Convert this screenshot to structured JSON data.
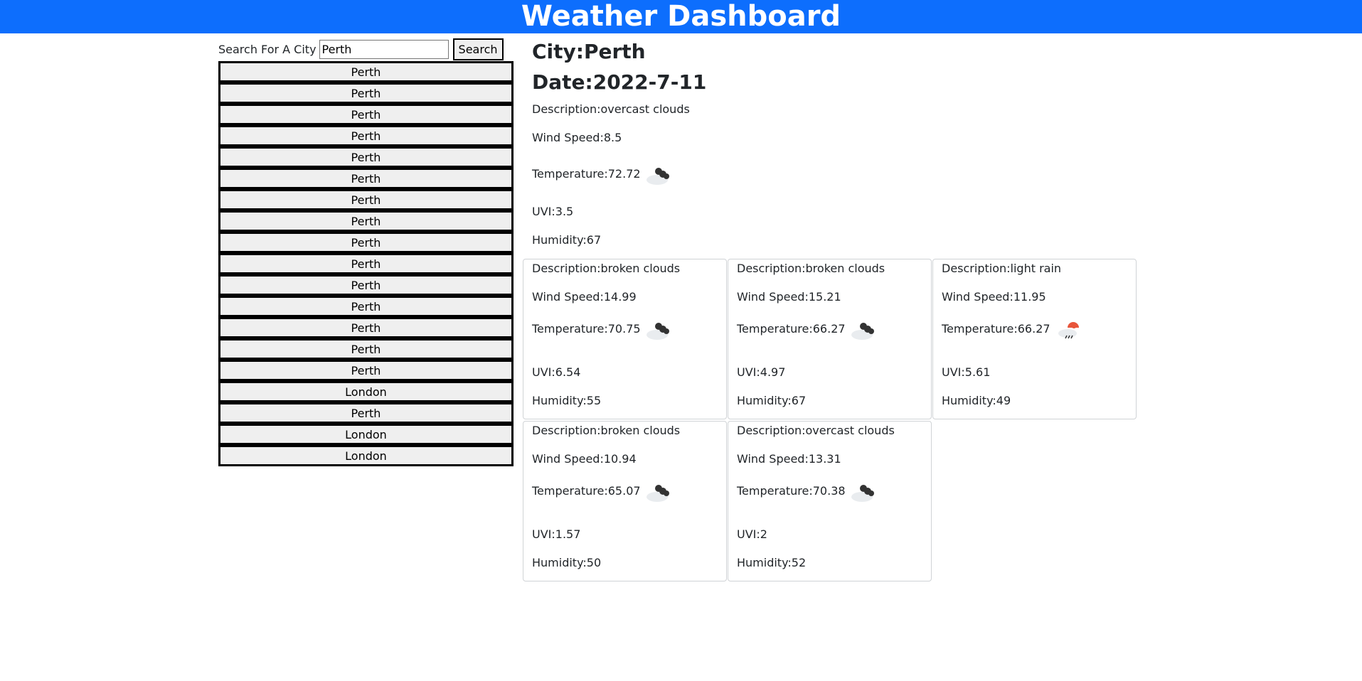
{
  "header": {
    "title": "Weather Dashboard"
  },
  "search": {
    "label": "Search For A City",
    "value": "Perth",
    "button_label": "Search"
  },
  "history": [
    "Perth",
    "Perth",
    "Perth",
    "Perth",
    "Perth",
    "Perth",
    "Perth",
    "Perth",
    "Perth",
    "Perth",
    "Perth",
    "Perth",
    "Perth",
    "Perth",
    "Perth",
    "London",
    "Perth",
    "London",
    "London"
  ],
  "current": {
    "city": "City:Perth",
    "date": "Date:2022-7-11",
    "description": "Description:overcast clouds",
    "wind": "Wind Speed:8.5",
    "temperature": "Temperature:72.72",
    "icon": "overcast-clouds-icon",
    "uvi": "UVI:3.5",
    "humidity": "Humidity:67"
  },
  "forecast": [
    {
      "description": "Description:broken clouds",
      "wind": "Wind Speed:14.99",
      "temperature": "Temperature:70.75",
      "icon": "broken-clouds-icon",
      "uvi": "UVI:6.54",
      "humidity": "Humidity:55"
    },
    {
      "description": "Description:broken clouds",
      "wind": "Wind Speed:15.21",
      "temperature": "Temperature:66.27",
      "icon": "broken-clouds-icon",
      "uvi": "UVI:4.97",
      "humidity": "Humidity:67"
    },
    {
      "description": "Description:light rain",
      "wind": "Wind Speed:11.95",
      "temperature": "Temperature:66.27",
      "icon": "light-rain-icon",
      "uvi": "UVI:5.61",
      "humidity": "Humidity:49"
    },
    {
      "description": "Description:broken clouds",
      "wind": "Wind Speed:10.94",
      "temperature": "Temperature:65.07",
      "icon": "broken-clouds-icon",
      "uvi": "UVI:1.57",
      "humidity": "Humidity:50"
    },
    {
      "description": "Description:overcast clouds",
      "wind": "Wind Speed:13.31",
      "temperature": "Temperature:70.38",
      "icon": "overcast-clouds-icon",
      "uvi": "UVI:2",
      "humidity": "Humidity:52"
    }
  ]
}
